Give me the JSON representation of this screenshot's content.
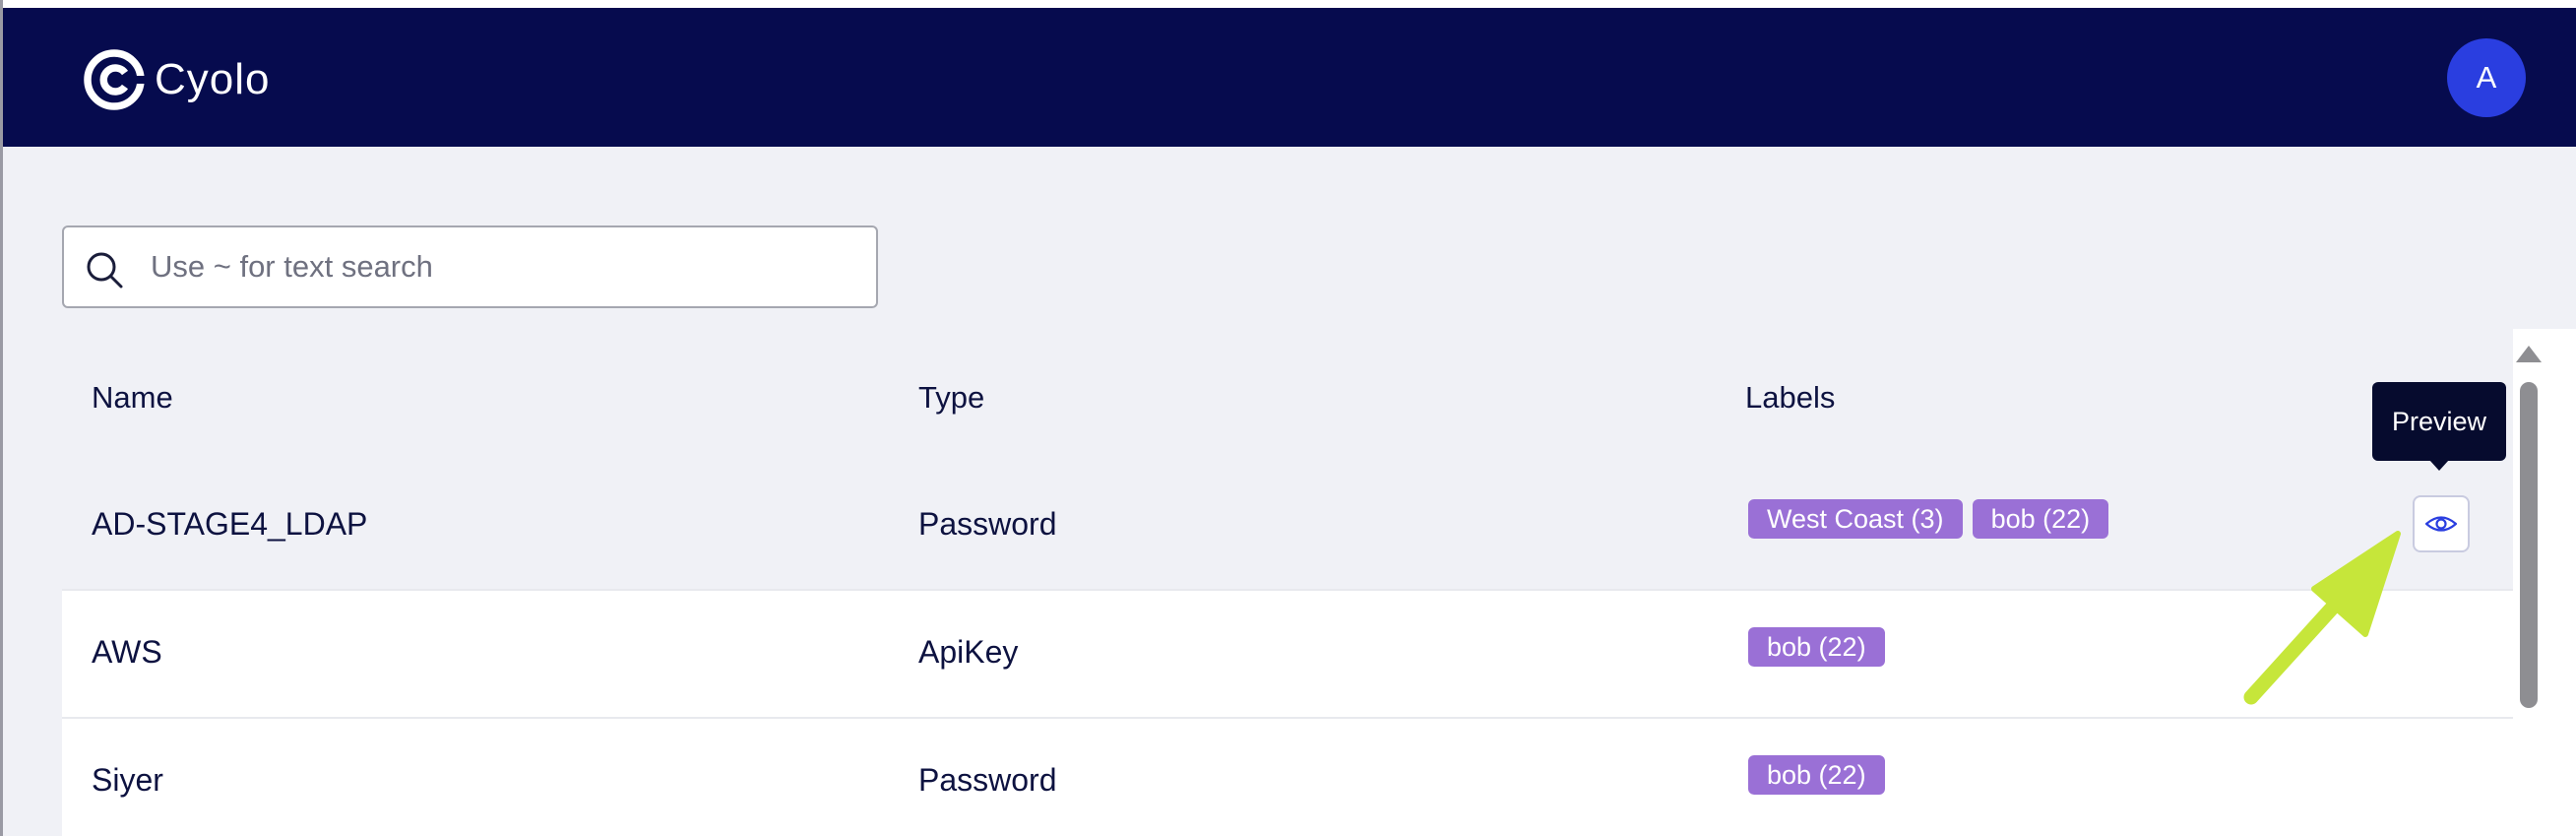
{
  "app": {
    "name": "Cyolo",
    "avatar_initial": "A"
  },
  "search": {
    "placeholder": "Use ~ for text search",
    "value": ""
  },
  "table": {
    "columns": [
      "Name",
      "Type",
      "Labels"
    ],
    "rows": [
      {
        "name": "AD-STAGE4_LDAP",
        "type": "Password",
        "labels": [
          "West Coast (3)",
          "bob (22)"
        ]
      },
      {
        "name": "AWS",
        "type": "ApiKey",
        "labels": [
          "bob (22)"
        ]
      },
      {
        "name": "Siyer",
        "type": "Password",
        "labels": [
          "bob (22)"
        ]
      }
    ]
  },
  "row_action": {
    "tooltip": "Preview",
    "icon": "eye-icon"
  },
  "colors": {
    "header_bg": "#060b4e",
    "avatar_bg": "#2a3ee0",
    "badge_bg": "#9a70d6",
    "annotation_arrow": "#c6e63a",
    "tooltip_bg": "#060b2e"
  }
}
